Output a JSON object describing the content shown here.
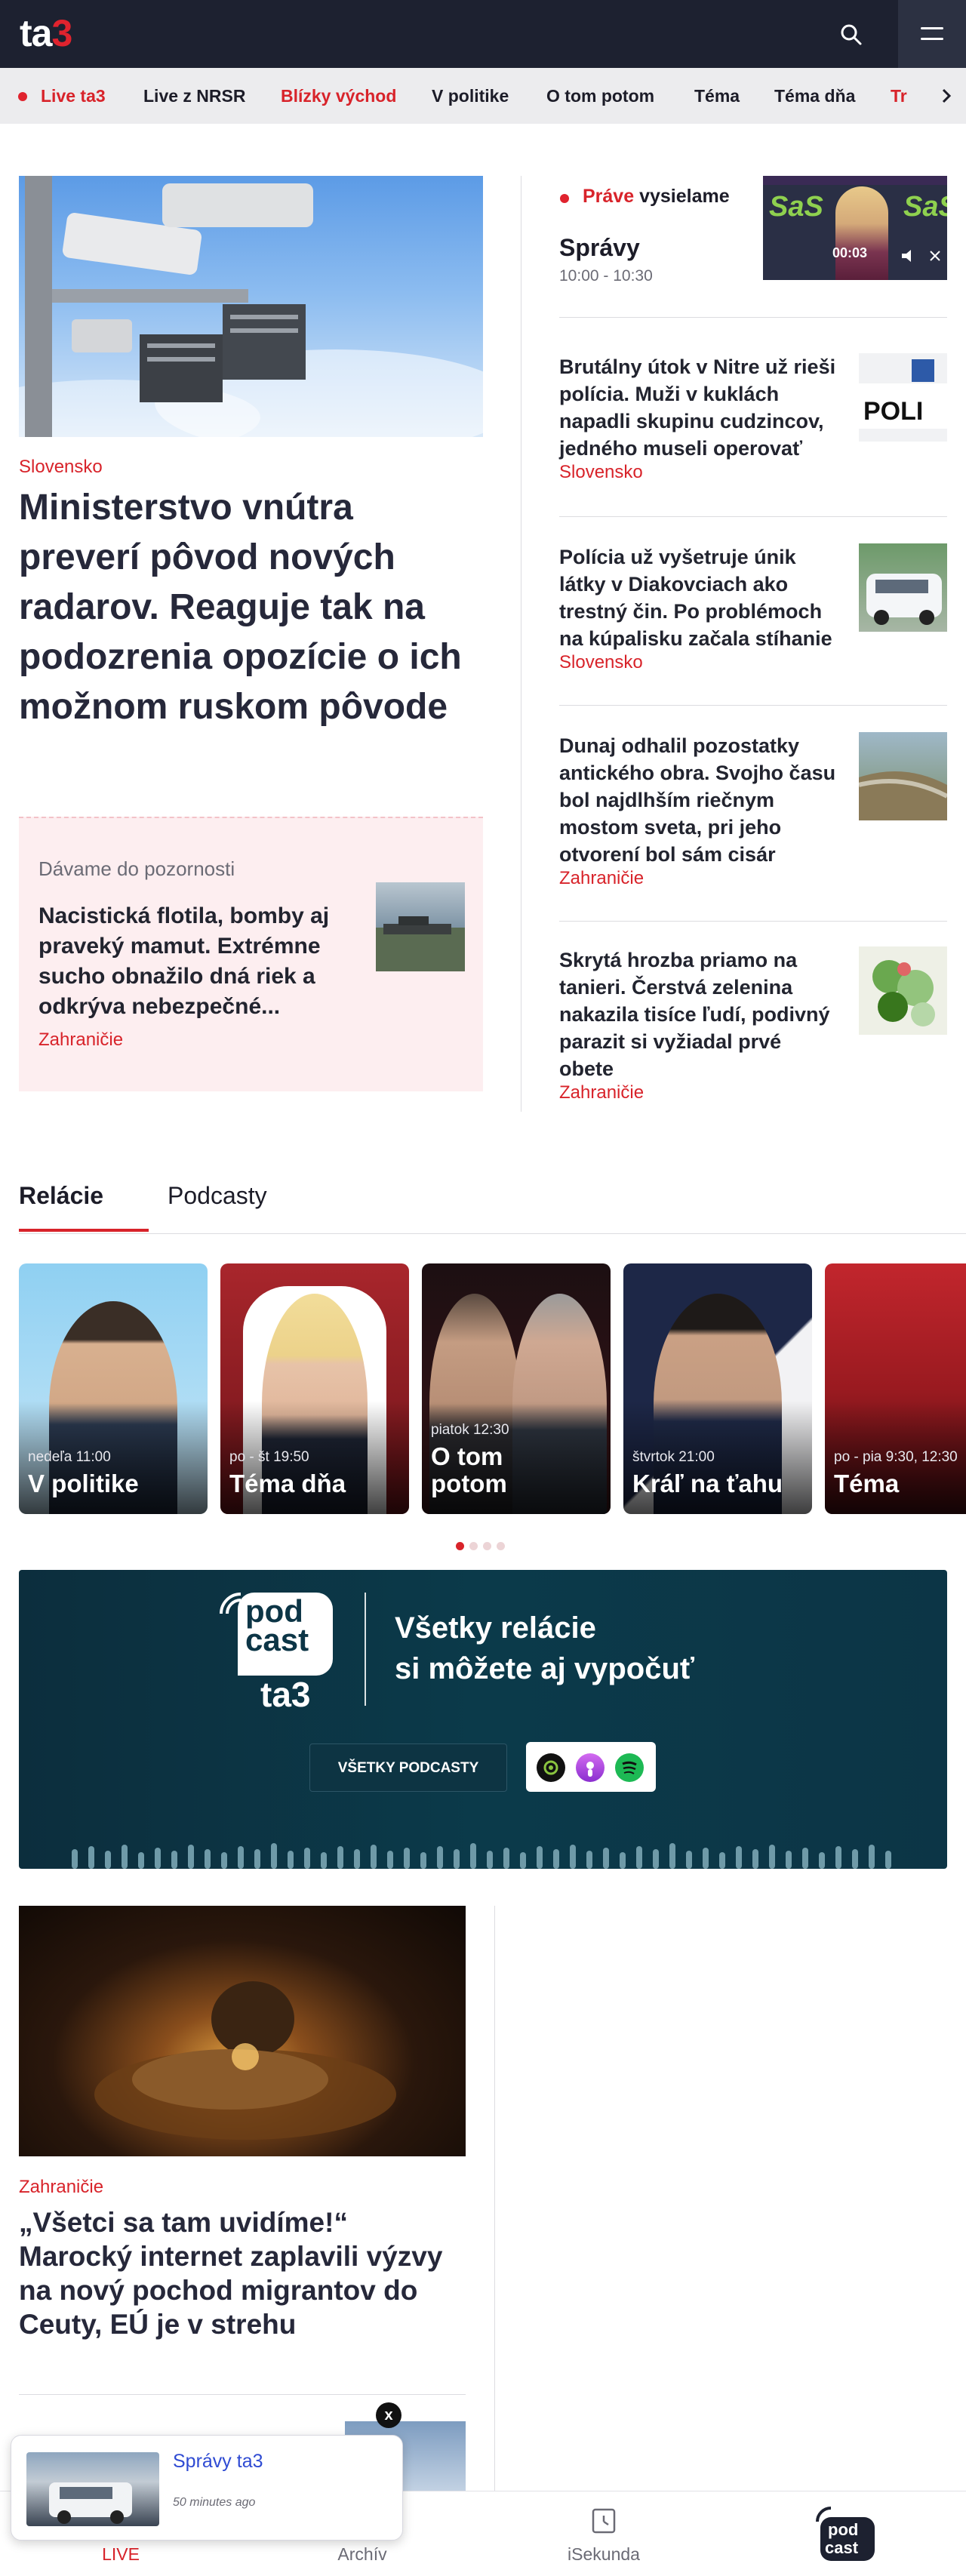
{
  "header": {
    "logo_main": "ta",
    "logo_number": "3"
  },
  "nav": {
    "items": [
      {
        "label": "Live ta3"
      },
      {
        "label": "Live z NRSR"
      },
      {
        "label": "Blízky východ"
      },
      {
        "label": "V politike"
      },
      {
        "label": "O tom potom"
      },
      {
        "label": "Téma"
      },
      {
        "label": "Téma dňa"
      },
      {
        "label": "Tr"
      }
    ]
  },
  "lead": {
    "section": "Slovensko",
    "title": "Ministerstvo vnútra preverí pôvod nových radarov. Reaguje tak na podozrenia opozície o ich možnom ruskom pôvode"
  },
  "promo": {
    "label": "Dávame do pozornosti",
    "title": "Nacistická flotila, bomby aj praveký mamut. Extrémne sucho obnažilo dná riek a odkrýva nebezpečné...",
    "section": "Zahraničie"
  },
  "live": {
    "title_red": "Práve",
    "title_rest": " vysielame",
    "show": "Správy",
    "time": "10:00 - 10:30",
    "video_time": "00:03",
    "video_brand": "SaS"
  },
  "side_articles": [
    {
      "title": "Brutálny útok v Nitre už rieši polícia. Muži v kuklách napadli skupinu cudzincov, jedného museli operovať",
      "section": "Slovensko"
    },
    {
      "title": "Polícia už vyšetruje únik látky v Diakovciach ako trestný čin. Po problémoch na kúpalisku začala stíhanie",
      "section": "Slovensko"
    },
    {
      "title": "Dunaj odhalil pozostatky antického obra. Svojho času bol najdlhším riečnym mostom sveta, pri jeho otvorení bol sám cisár",
      "section": "Zahraničie"
    },
    {
      "title": "Skrytá hrozba priamo na tanieri. Čerstvá zelenina nakazila tisíce ľudí, podivný parazit si vyžiadal prvé obete",
      "section": "Zahraničie"
    }
  ],
  "tabs": [
    {
      "label": "Relácie"
    },
    {
      "label": "Podcasty"
    }
  ],
  "shows": [
    {
      "time": "nedeľa 11:00",
      "name": "V politike"
    },
    {
      "time": "po - št 19:50",
      "name": "Téma dňa"
    },
    {
      "time": "piatok 12:30",
      "name": "O tom potom"
    },
    {
      "time": "štvrtok 21:00",
      "name": "Kráľ na ťahu"
    },
    {
      "time": "po - pia 9:30, 12:30",
      "name": "Téma"
    }
  ],
  "podcast": {
    "badge_line1": "pod",
    "badge_line2": "cast",
    "badge_brand": "ta3",
    "headline_1": "Všetky relácie",
    "headline_2": "si môžete aj vypočuť",
    "button": "VŠETKY PODCASTY",
    "apps": [
      "Google Podcasts",
      "Apple Podcasts",
      "Spotify"
    ]
  },
  "bottom_article": {
    "section": "Zahraničie",
    "title": "„Všetci sa tam uvidíme!“ Marocký internet zaplavili výzvy na nový pochod migrantov do Ceuty, EÚ je v strehu"
  },
  "toast": {
    "title": "Správy ta3",
    "time": "50 minutes ago",
    "close": "x"
  },
  "bottom_nav": [
    {
      "label": "LIVE"
    },
    {
      "label": "Archív"
    },
    {
      "label": "iSekunda"
    },
    {
      "label": ""
    }
  ],
  "colors": {
    "brand_red": "#d8232a",
    "header_bg": "#1d2130",
    "podcast_bg": "#0b3a4a",
    "nav_bg": "#ececee"
  }
}
